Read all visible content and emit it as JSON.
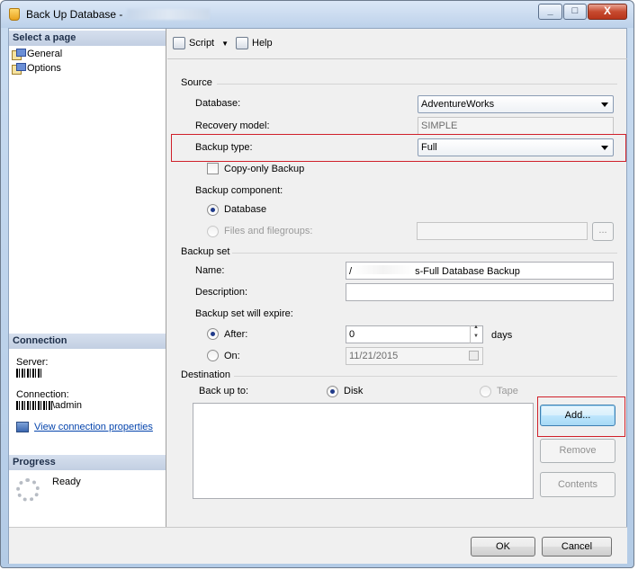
{
  "window": {
    "title": "Back Up Database -",
    "min_glyph": "_",
    "max_glyph": "□",
    "close_glyph": "X"
  },
  "left": {
    "select_page_header": "Select a page",
    "pages": [
      {
        "label": "General"
      },
      {
        "label": "Options"
      }
    ],
    "connection_header": "Connection",
    "server_label": "Server:",
    "connection_label": "Connection:",
    "connection_user_suffix": "\\admin",
    "view_connection_link": "View connection properties",
    "progress_header": "Progress",
    "progress_status": "Ready"
  },
  "toolbar": {
    "script_label": "Script",
    "help_label": "Help"
  },
  "source": {
    "group_label": "Source",
    "database_label": "Database:",
    "database_value": "AdventureWorks",
    "recovery_label": "Recovery model:",
    "recovery_value": "SIMPLE",
    "backup_type_label": "Backup type:",
    "backup_type_value": "Full",
    "copy_only_label": "Copy-only Backup",
    "component_label": "Backup component:",
    "component_database": "Database",
    "component_files": "Files and filegroups:",
    "files_browse": "..."
  },
  "backup_set": {
    "group_label": "Backup set",
    "name_label": "Name:",
    "name_value_prefix": "/",
    "name_value_suffix": "s-Full Database Backup",
    "description_label": "Description:",
    "description_value": "",
    "expire_label": "Backup set will expire:",
    "after_label": "After:",
    "after_value": "0",
    "days_label": "days",
    "on_label": "On:",
    "on_value": "11/21/2015"
  },
  "destination": {
    "group_label": "Destination",
    "backup_to_label": "Back up to:",
    "disk_label": "Disk",
    "tape_label": "Tape",
    "add_button": "Add...",
    "remove_button": "Remove",
    "contents_button": "Contents"
  },
  "footer": {
    "ok_button": "OK",
    "cancel_button": "Cancel"
  },
  "colors": {
    "highlight_border": "#d0202a",
    "link": "#0645ad"
  }
}
